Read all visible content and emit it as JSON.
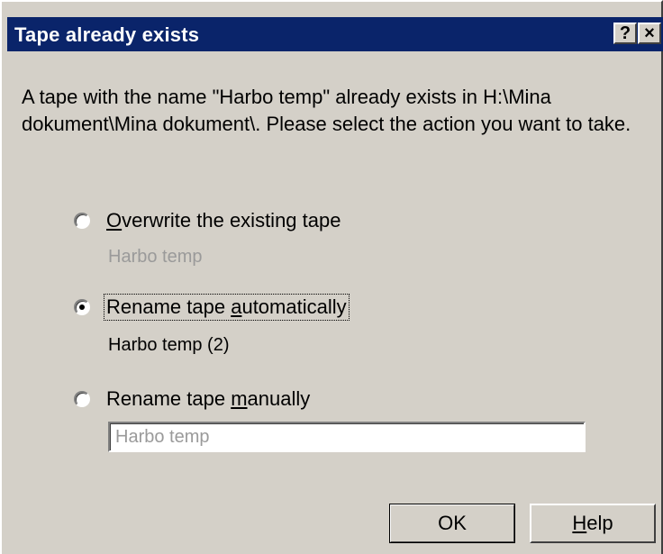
{
  "dialog": {
    "title": "Tape already exists",
    "help_caption": "?",
    "close_caption": "×",
    "message": "A tape with the name \"Harbo temp\" already exists in H:\\Mina dokument\\Mina dokument\\. Please select the action you want to take.",
    "options": [
      {
        "pre": "",
        "accel": "O",
        "post": "verwrite the existing tape",
        "selected": false,
        "detail": "Harbo temp",
        "detail_enabled": false
      },
      {
        "pre": "Rename tape ",
        "accel": "a",
        "post": "utomatically",
        "selected": true,
        "detail": "Harbo temp (2)",
        "detail_enabled": true
      },
      {
        "pre": "Rename tape ",
        "accel": "m",
        "post": "anually",
        "selected": false
      }
    ],
    "manual_name_value": "Harbo temp",
    "ok_label": "OK",
    "help_label_accel": "H",
    "help_label_rest": "elp"
  }
}
